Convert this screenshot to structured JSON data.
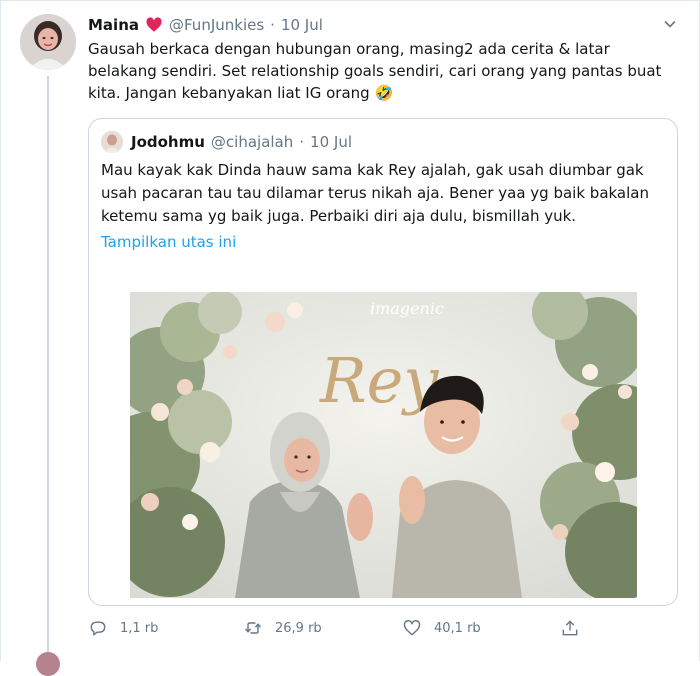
{
  "tweet": {
    "author_name": "Maina",
    "handle": "@FunJunkies",
    "separator": "·",
    "date": "10 Jul",
    "text": "Gausah berkaca dengan hubungan orang, masing2 ada cerita & latar belakang sendiri. Set relationship goals sendiri, cari orang yang pantas buat kita. Jangan kebanyakan liat IG orang",
    "emoji": "🤣",
    "more_icon": "chevron-down-icon"
  },
  "quoted_tweet": {
    "author_name": "Jodohmu",
    "handle": "@cihajalah",
    "separator": "·",
    "date": "10 Jul",
    "text": "Mau kayak kak Dinda hauw sama kak Rey ajalah, gak usah diumbar gak usah pacaran tau tau dilamar terus nikah aja. Bener yaa yg baik bakalan ketemu sama yg baik juga. Perbaiki diri aja dulu, bismillah yuk.",
    "show_thread_link": "Tampilkan utas ini",
    "photo": {
      "watermark": "imagenic",
      "sign_text": "Rey"
    }
  },
  "actions": {
    "reply_count": "1,1 rb",
    "retweet_count": "26,9 rb",
    "like_count": "40,1 rb"
  },
  "colors": {
    "link": "#1da1f2",
    "secondary": "#657786",
    "border": "#ccd6dd",
    "heart": "#e0245e"
  }
}
